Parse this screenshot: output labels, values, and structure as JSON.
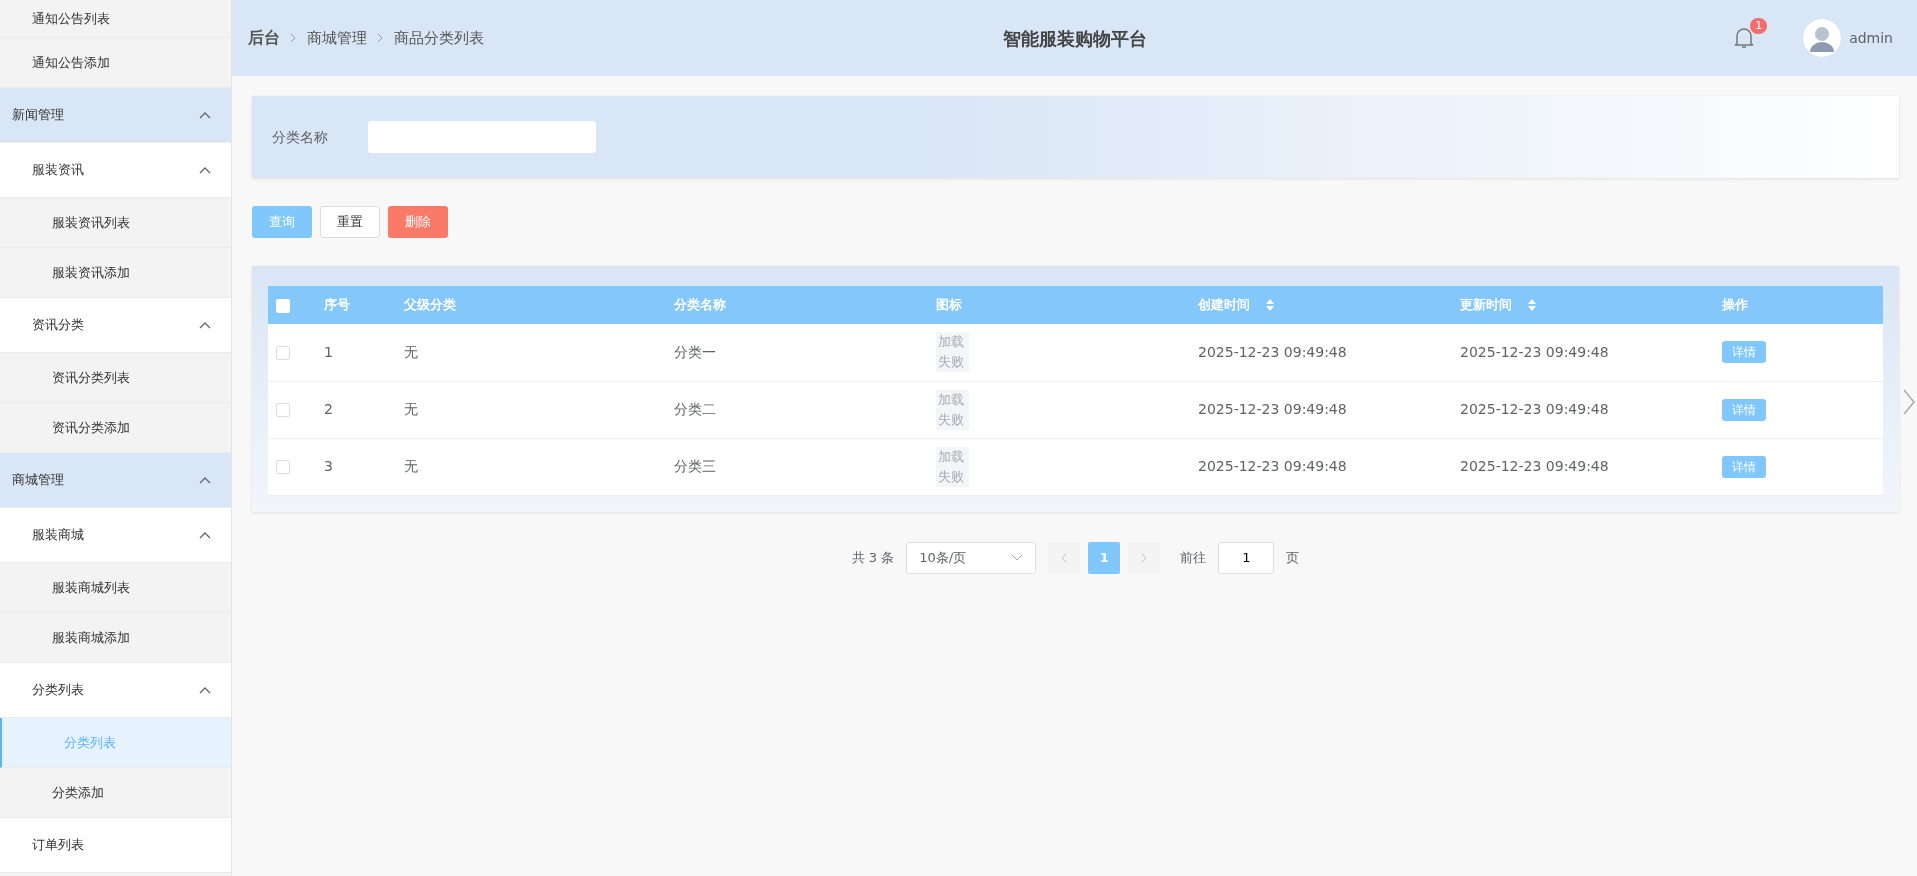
{
  "sidebar": {
    "continued_items": [
      {
        "label": "通知公告列表",
        "selected": false
      },
      {
        "label": "通知公告添加",
        "selected": false
      }
    ],
    "items": [
      {
        "label": "新闻管理",
        "expanded": true,
        "children": [
          {
            "label": "服装资讯",
            "expanded": true,
            "children": [
              {
                "label": "服装资讯列表",
                "selected": false
              },
              {
                "label": "服装资讯添加",
                "selected": false
              }
            ]
          },
          {
            "label": "资讯分类",
            "expanded": true,
            "children": [
              {
                "label": "资讯分类列表",
                "selected": false
              },
              {
                "label": "资讯分类添加",
                "selected": false
              }
            ]
          }
        ]
      },
      {
        "label": "商城管理",
        "expanded": true,
        "children": [
          {
            "label": "服装商城",
            "expanded": true,
            "children": [
              {
                "label": "服装商城列表",
                "selected": false
              },
              {
                "label": "服装商城添加",
                "selected": false
              }
            ]
          },
          {
            "label": "分类列表",
            "expanded": true,
            "children": [
              {
                "label": "分类列表",
                "selected": true
              },
              {
                "label": "分类添加",
                "selected": false
              }
            ]
          },
          {
            "label": "订单列表",
            "selected": false
          }
        ]
      }
    ]
  },
  "header": {
    "breadcrumb": [
      "后台",
      "商城管理",
      "商品分类列表"
    ],
    "title": "智能服装购物平台",
    "notification_count": "1",
    "user": "admin"
  },
  "search": {
    "label": "分类名称"
  },
  "buttons": [
    {
      "label": "查询",
      "kind": "primary"
    },
    {
      "label": "重置",
      "kind": "default"
    },
    {
      "label": "删除",
      "kind": "danger"
    }
  ],
  "table": {
    "select_all": false,
    "columns": [
      {
        "label": "序号",
        "sortable": false
      },
      {
        "label": "父级分类",
        "sortable": false
      },
      {
        "label": "分类名称",
        "sortable": false
      },
      {
        "label": "图标",
        "sortable": false
      },
      {
        "label": "创建时间",
        "sortable": true
      },
      {
        "label": "更新时间",
        "sortable": true
      },
      {
        "label": "操作",
        "sortable": false
      }
    ],
    "rows": [
      {
        "checked": false,
        "index": "1",
        "parent": "无",
        "name": "分类一",
        "icon": "加载失败",
        "created": "2025-12-23 09:49:48",
        "updated": "2025-12-23 09:49:48",
        "action": "详情"
      },
      {
        "checked": false,
        "index": "2",
        "parent": "无",
        "name": "分类二",
        "icon": "加载失败",
        "created": "2025-12-23 09:49:48",
        "updated": "2025-12-23 09:49:48",
        "action": "详情"
      },
      {
        "checked": false,
        "index": "3",
        "parent": "无",
        "name": "分类三",
        "icon": "加载失败",
        "created": "2025-12-23 09:49:48",
        "updated": "2025-12-23 09:49:48",
        "action": "详情"
      }
    ]
  },
  "pagination": {
    "total": "共 3 条",
    "page_size": "10条/页",
    "pages": [
      {
        "label": "1",
        "selected": true
      }
    ],
    "goto_label": "前往",
    "goto_value": "1",
    "page_unit": "页"
  }
}
